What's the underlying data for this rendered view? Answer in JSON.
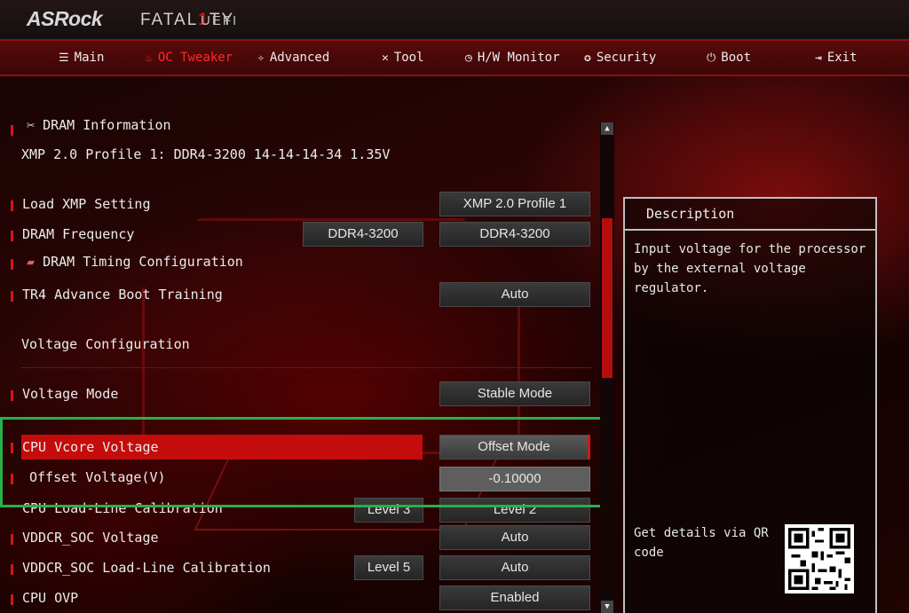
{
  "header": {
    "brand": "ASRock",
    "edition_pre": "FATAL",
    "edition_one": "1",
    "edition_post": "TY",
    "product": "UEFI"
  },
  "nav": {
    "tabs": [
      {
        "label": "Main",
        "icon": "list-icon"
      },
      {
        "label": "OC Tweaker",
        "icon": "flame-icon",
        "active": true
      },
      {
        "label": "Advanced",
        "icon": "star-icon"
      },
      {
        "label": "Tool",
        "icon": "tools-icon"
      },
      {
        "label": "H/W Monitor",
        "icon": "monitor-icon"
      },
      {
        "label": "Security",
        "icon": "shield-icon"
      },
      {
        "label": "Boot",
        "icon": "power-icon"
      },
      {
        "label": "Exit",
        "icon": "exit-icon"
      }
    ]
  },
  "settings": {
    "dram_info": "DRAM Information",
    "xmp_profile_line": "XMP 2.0 Profile 1: DDR4-3200 14-14-14-34 1.35V",
    "load_xmp": {
      "label": "Load XMP Setting",
      "value": "XMP 2.0 Profile 1"
    },
    "dram_freq": {
      "label": "DRAM Frequency",
      "current": "DDR4-3200",
      "value": "DDR4-3200"
    },
    "dram_timing": "DRAM Timing Configuration",
    "tr4_training": {
      "label": "TR4 Advance Boot Training",
      "value": "Auto"
    },
    "voltage_config": "Voltage Configuration",
    "voltage_mode": {
      "label": "Voltage Mode",
      "value": "Stable Mode"
    },
    "cpu_vcore": {
      "label": "CPU Vcore Voltage",
      "value": "Offset Mode"
    },
    "offset_voltage": {
      "label": "Offset Voltage(V)",
      "value": "-0.10000"
    },
    "cpu_llc": {
      "label": "CPU Load-Line Calibration",
      "current": "Level 3",
      "value": "Level 2"
    },
    "vddcr_soc": {
      "label": "VDDCR_SOC Voltage",
      "value": "Auto"
    },
    "vddcr_soc_llc": {
      "label": "VDDCR_SOC Load-Line Calibration",
      "current": "Level 5",
      "value": "Auto"
    },
    "cpu_ovp": {
      "label": "CPU OVP",
      "value": "Enabled"
    }
  },
  "description": {
    "title": "Description",
    "text": "Input voltage for the processor by the external voltage regulator.",
    "qr_text": "Get details via QR code"
  },
  "colors": {
    "accent": "#c40c0c",
    "highlight_frame": "#28b04a"
  }
}
